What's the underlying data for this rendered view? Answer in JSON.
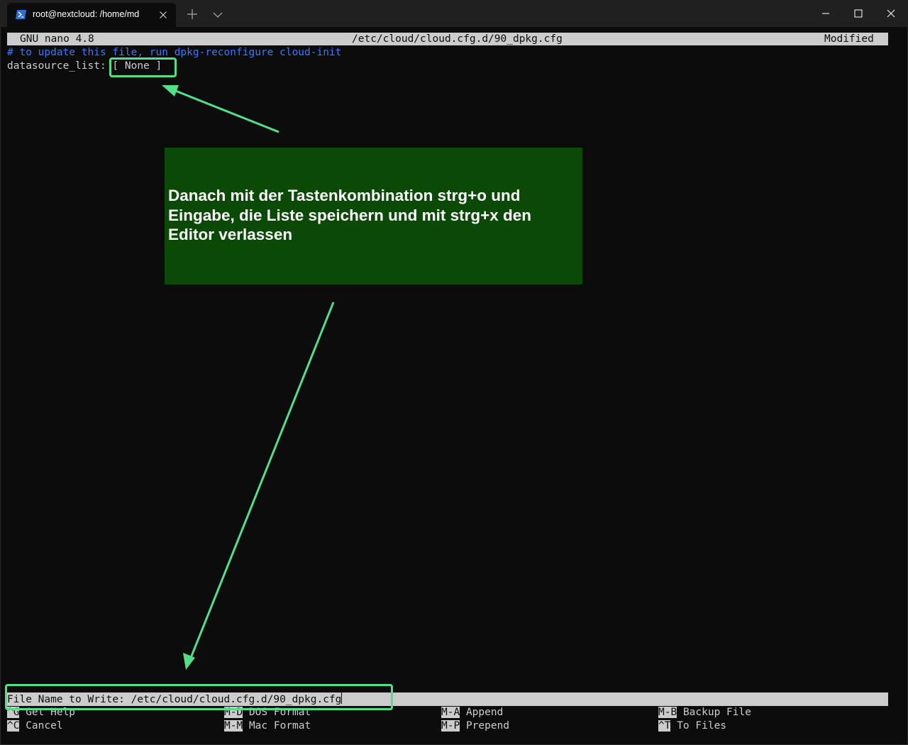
{
  "window": {
    "tab_title": "root@nextcloud: /home/md"
  },
  "nano": {
    "version": "GNU nano 4.8",
    "filename": "/etc/cloud/cloud.cfg.d/90_dpkg.cfg",
    "status": "Modified",
    "lines": [
      "# to update this file, run dpkg-reconfigure cloud-init",
      "datasource_list: [ None ]"
    ],
    "prompt": "File Name to Write: /etc/cloud/cloud.cfg.d/90_dpkg.cfg",
    "shortcuts": [
      {
        "key": "^G",
        "label": "Get Help"
      },
      {
        "key": "M-D",
        "label": "DOS Format"
      },
      {
        "key": "M-A",
        "label": "Append"
      },
      {
        "key": "M-B",
        "label": "Backup File"
      },
      {
        "key": "^C",
        "label": "Cancel"
      },
      {
        "key": "M-M",
        "label": "Mac Format"
      },
      {
        "key": "M-P",
        "label": "Prepend"
      },
      {
        "key": "^T",
        "label": "To Files"
      }
    ]
  },
  "annotation": {
    "text": "Danach mit der Tastenkombination strg+o und Eingabe, die Liste speichern und mit strg+x den Editor verlassen",
    "color": "#50e08a",
    "box_color": "#0b4a06"
  }
}
